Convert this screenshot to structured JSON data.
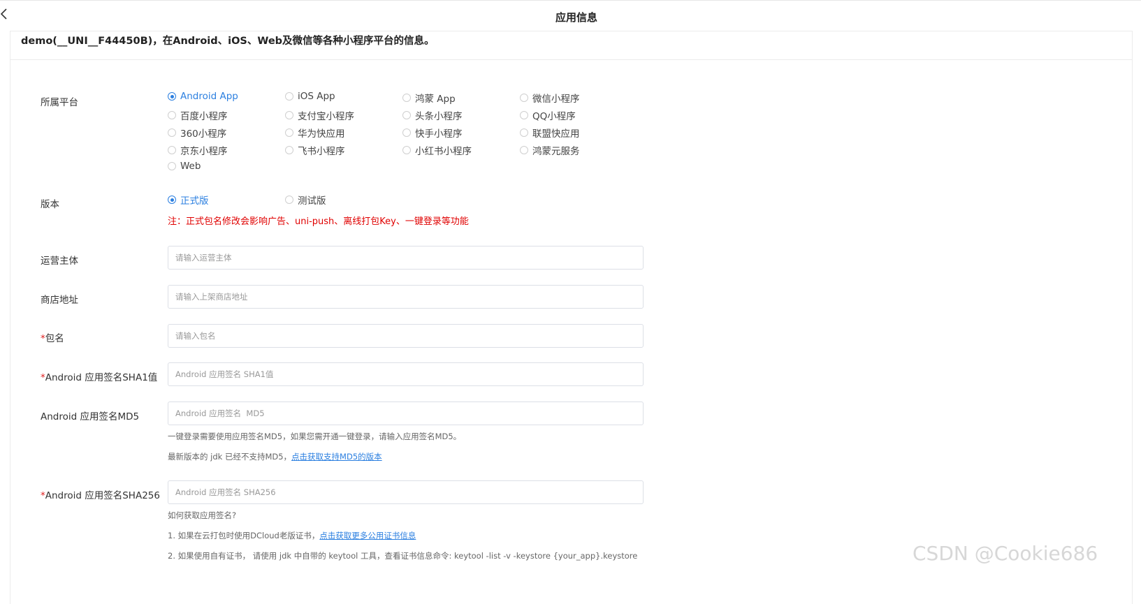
{
  "header": {
    "title": "应用信息"
  },
  "app": {
    "description": "demo(__UNI__F44450B)，在Android、iOS、Web及微信等各种小程序平台的信息。"
  },
  "platform": {
    "label": "所属平台",
    "options": [
      "Android App",
      "iOS App",
      "鸿蒙 App",
      "微信小程序",
      "百度小程序",
      "支付宝小程序",
      "头条小程序",
      "QQ小程序",
      "360小程序",
      "华为快应用",
      "快手小程序",
      "联盟快应用",
      "京东小程序",
      "飞书小程序",
      "小红书小程序",
      "鸿蒙元服务",
      "Web"
    ],
    "selected": "Android App"
  },
  "version": {
    "label": "版本",
    "options": [
      "正式版",
      "测试版"
    ],
    "selected": "正式版",
    "note": "注：正式包名修改会影响广告、uni-push、离线打包Key、一键登录等功能"
  },
  "fields": {
    "operator": {
      "label": "运营主体",
      "placeholder": "请输入运营主体",
      "value": ""
    },
    "store": {
      "label": "商店地址",
      "placeholder": "请输入上架商店地址",
      "value": ""
    },
    "package": {
      "required_mark": "*",
      "label": "包名",
      "placeholder": "请输入包名",
      "value": ""
    },
    "sha1": {
      "required_mark": "*",
      "label": "Android 应用签名SHA1值",
      "placeholder": "Android 应用签名 SHA1值",
      "value": ""
    },
    "md5": {
      "label": "Android 应用签名MD5",
      "placeholder": "Android 应用签名  MD5",
      "value": "",
      "hint1": "一键登录需要使用应用签名MD5，如果您需开通一键登录，请输入应用签名MD5。",
      "hint2_prefix": "最新版本的 jdk 已经不支持MD5，",
      "hint2_link": "点击获取支持MD5的版本"
    },
    "sha256": {
      "required_mark": "*",
      "label": "Android 应用签名SHA256",
      "placeholder": "Android 应用签名 SHA256",
      "value": "",
      "help_title": "如何获取应用签名?",
      "help1_prefix": "1. 如果在云打包时使用DCloud老版证书，",
      "help1_link": "点击获取更多公用证书信息",
      "help2": "2. 如果使用自有证书， 请使用 jdk 中自带的 keytool 工具，查看证书信息命令: keytool -list -v -keystore {your_app}.keystore"
    }
  },
  "watermark": "CSDN @Cookie686",
  "colors": {
    "accent": "#2b7fe0",
    "warning": "#e00000",
    "required": "#e02020"
  }
}
